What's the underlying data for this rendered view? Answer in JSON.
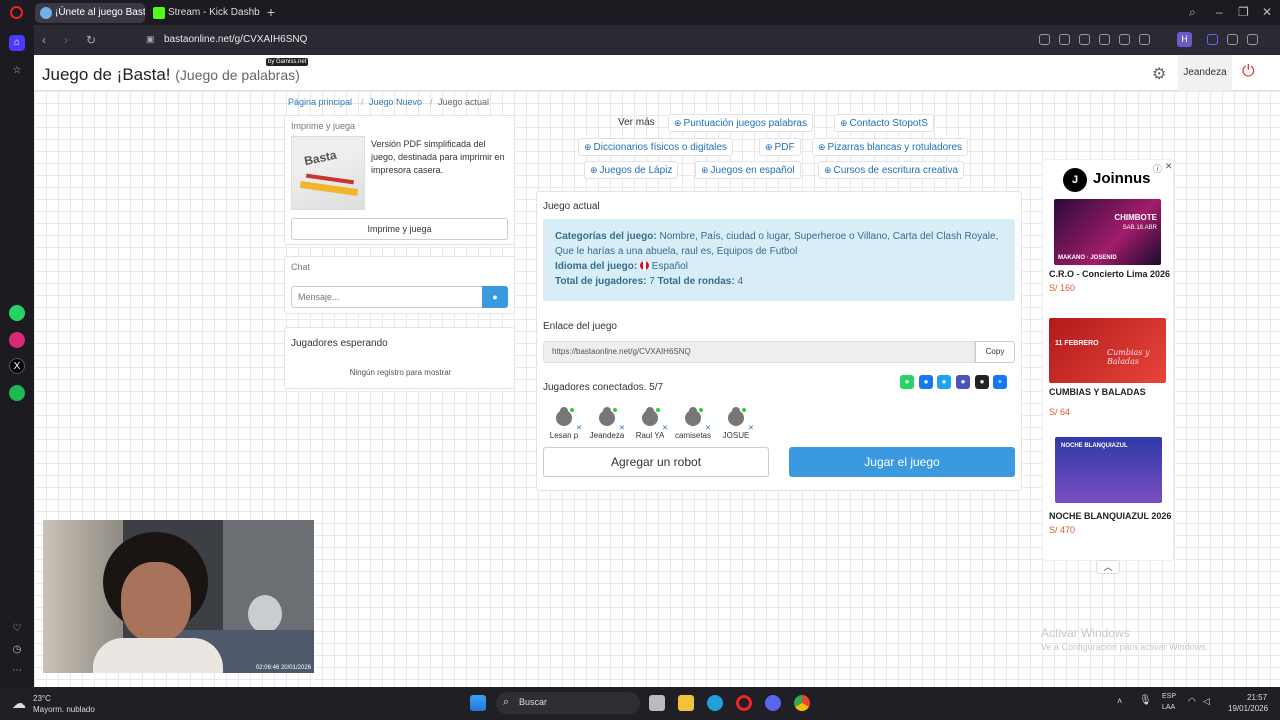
{
  "browser": {
    "tabs": [
      {
        "label": "¡Únete al juego Basta!",
        "active": true
      },
      {
        "label": "Stream - Kick Dashboard",
        "active": false
      }
    ],
    "url": "bastaonline.net/g/CVXAIH6SNQ"
  },
  "header": {
    "title": "Juego de ¡Basta!",
    "subtitle": "(Juego de palabras)",
    "badge": "by Gamiss.net",
    "username": "Jeandeza"
  },
  "breadcrumb": [
    "Página principal",
    "Juego Nuevo",
    "Juego actual"
  ],
  "print_panel": {
    "header": "Imprime y juega",
    "description": "Versión PDF simplificada del juego, destinada para imprimir en impresora casera.",
    "button": "Imprime y juega",
    "image_label": "Basta"
  },
  "chat": {
    "header": "Chat",
    "placeholder": "Mensaje..."
  },
  "waiting": {
    "header": "Jugadores esperando",
    "empty": "Ningún registro para mostrar"
  },
  "links": {
    "ver_mas": "Ver más",
    "items": [
      "Puntuación juegos palabras",
      "Contacto StopotS",
      "Diccionarios físicos o digitales",
      "PDF",
      "Pizarras blancas y rotuladores",
      "Juegos de Lápiz",
      "Juegos en español",
      "Cursos de escritura creativa"
    ]
  },
  "game": {
    "header": "Juego actual",
    "categories_label": "Categorías del juego:",
    "categories": "Nombre, País, ciudad o lugar, Superheroe o Villano, Carta del Clash Royale, Que le harías a una abuela, raul es, Equipos de Futbol",
    "language_label": "Idioma del juego:",
    "language": "Español",
    "players_label": "Total de jugadores:",
    "players": "7",
    "rounds_label": "Total de rondas:",
    "rounds": "4",
    "link_label": "Enlace del juego",
    "link": "https://bastaonline.net/g/CVXAIH6SNQ",
    "copy": "Copy",
    "connected": "Jugadores conectados. 5/7",
    "player_names": [
      "Lesan p",
      "Jeandeza",
      "Raul YA",
      "camisetas",
      "JOSUE"
    ],
    "add_robot": "Agregar un robot",
    "play": "Jugar el juego"
  },
  "ads": {
    "brand": "Joinnus",
    "items": [
      {
        "title": "C.R.O - Concierto Lima 2026",
        "price": "S/ 160",
        "img_text": "CHIMBOTE",
        "img_sub": "SAB.18.ABR",
        "img_names": "MAKANO · JOSENID"
      },
      {
        "title": "CUMBIAS Y BALADAS",
        "price": "S/ 64",
        "img_text": "11 FEBRERO",
        "img_sub": "Cumbias y Baladas"
      },
      {
        "title": "NOCHE BLANQUIAZUL 2026",
        "price": "S/ 470",
        "img_text": "NOCHE BLANQUIAZUL"
      }
    ]
  },
  "watermark": {
    "line1": "Activar Windows",
    "line2": "Ve a Configuración para activar Windows."
  },
  "taskbar": {
    "temp": "23°C",
    "weather": "Mayorm. nublado",
    "search": "Buscar",
    "lang1": "ESP",
    "lang2": "LAA",
    "time": "21:57",
    "date": "19/01/2026"
  },
  "webcam_timestamp": "02:06:46 20/01/2026",
  "colors": {
    "accent": "#3b99e0",
    "info_bg": "#d9edf7",
    "link": "#1e70b8"
  }
}
